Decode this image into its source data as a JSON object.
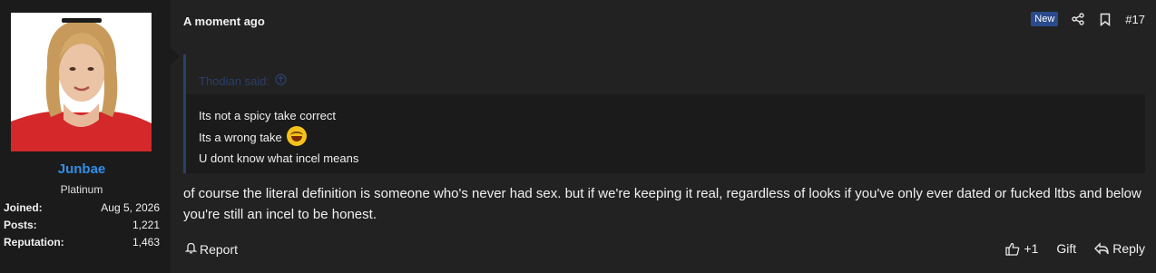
{
  "user": {
    "name": "Junbae",
    "title": "Platinum",
    "stats": [
      {
        "label": "Joined:",
        "value": "Aug 5, 2026"
      },
      {
        "label": "Posts:",
        "value": "1,221"
      },
      {
        "label": "Reputation:",
        "value": "1,463"
      }
    ]
  },
  "post": {
    "timestamp": "A moment ago",
    "badge": "New",
    "number": "#17",
    "quote": {
      "author": "Thodian said:",
      "lines": [
        "Its not a spicy take correct",
        "Its a wrong take",
        "U dont know what incel means"
      ]
    },
    "message": "of course the literal definition is someone who's never had sex. but if we're keeping it real, regardless of looks if you've only ever dated or fucked ltbs and below you're still an incel to be honest.",
    "actions": {
      "report": "Report",
      "reactions": "+1",
      "gift": "Gift",
      "reply": "Reply"
    }
  },
  "colors": {
    "username": "#2f8fe8",
    "badge_bg": "#2a4a8c",
    "quote_author": "#2b3f6b"
  }
}
